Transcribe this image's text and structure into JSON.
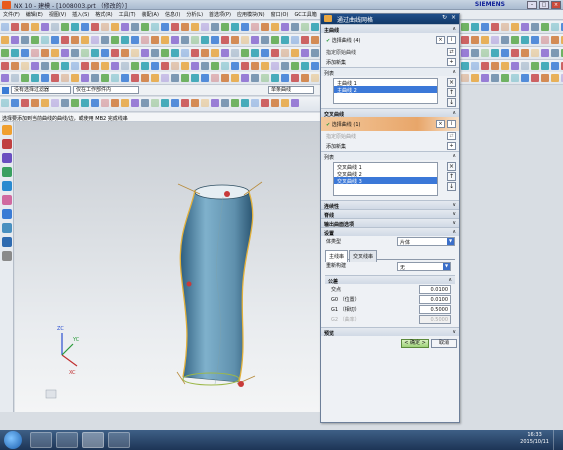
{
  "window": {
    "title": "NX 10 - 建模 - [1008003.prt （修改的）]",
    "brand": "SIEMENS"
  },
  "menu": [
    "文件(F)",
    "编辑(E)",
    "视图(V)",
    "插入(S)",
    "格式(R)",
    "工具(T)",
    "装配(A)",
    "信息(I)",
    "分析(L)",
    "首选项(P)",
    "应用模块(N)",
    "窗口(O)",
    "GC工具箱"
  ],
  "selbar": {
    "filter": "没有选择过滤器",
    "scope": "仅在工作部件内",
    "curve_rule": "单条曲线"
  },
  "status_prompt": "选择要添加到当前曲线的曲线/边，或使用 MB2 完成线串",
  "dialog": {
    "title": "通过曲线网格",
    "primary": {
      "header": "主曲线",
      "select": "选择曲线 (4)",
      "specify_origin": "指定原始曲线",
      "add_new": "添加新集",
      "list_header": "列表",
      "items": [
        "主曲线 1",
        "主曲线 2"
      ]
    },
    "cross": {
      "header": "交叉曲线",
      "select": "选择曲线 (1)",
      "specify_origin": "指定原始曲线",
      "add_new": "添加新集",
      "list_header": "列表",
      "items": [
        "交叉曲线 1",
        "交叉曲线 2",
        "交叉曲线 3"
      ]
    },
    "collapsed": [
      "连续性",
      "脊线",
      "输出曲面选项"
    ],
    "settings": {
      "header": "设置",
      "body_type_label": "体类型",
      "body_type": "片体",
      "tabs": [
        "主线串",
        "交叉线串"
      ],
      "rebuild_label": "重新构建",
      "rebuild": "无"
    },
    "tolerance": {
      "header": "公差",
      "rows": [
        {
          "label": "交点",
          "value": "0.0100"
        },
        {
          "label": "G0 （位置）",
          "value": "0.0100"
        },
        {
          "label": "G1 （相切）",
          "value": "0.5000"
        },
        {
          "label": "G2 （曲率）",
          "value": "0.5000"
        }
      ]
    },
    "preview": "预览",
    "ok": "< 确定 >",
    "cancel": "取消"
  },
  "clock": {
    "time": "16:33",
    "date": "2015/10/11"
  },
  "colors": {
    "surface": "#6b9cb8",
    "dialog_title": "#1f4e8a",
    "selection_orange": "#e8a66a",
    "list_selected": "#3b78d8"
  }
}
